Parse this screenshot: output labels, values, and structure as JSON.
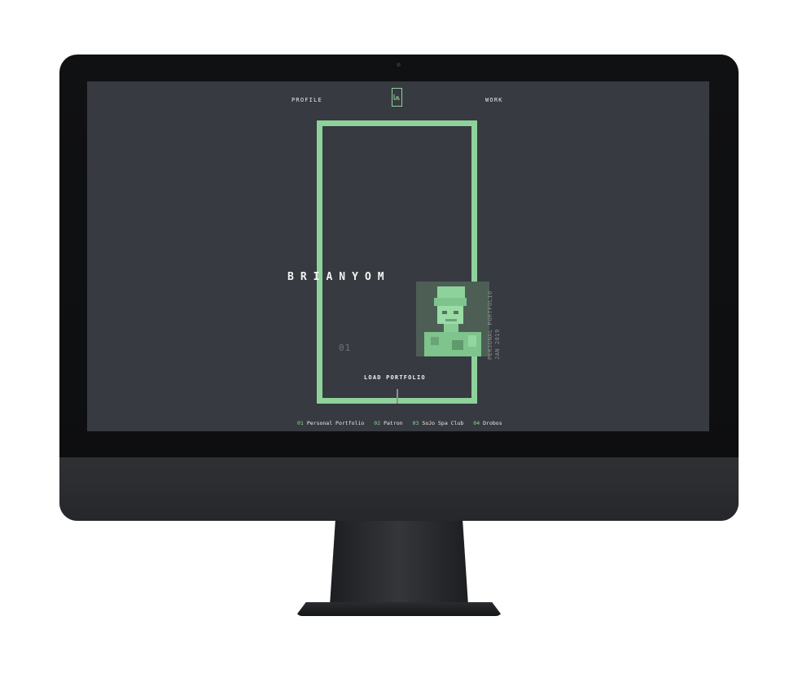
{
  "nav": {
    "profile_label": "PROFILE",
    "work_label": "WORK"
  },
  "hero": {
    "name": "BRIANYOM",
    "index": "01",
    "load_label": "LOAD PORTFOLIO",
    "vertical_label_line1": "PERSONAL PORTFOLIO",
    "vertical_label_line2": "JAN 2019"
  },
  "projects": [
    {
      "num": "01",
      "name": "Personal Portfolio"
    },
    {
      "num": "02",
      "name": "Patron"
    },
    {
      "num": "03",
      "name": "SoJo Spa Club"
    },
    {
      "num": "04",
      "name": "Drobos"
    }
  ],
  "colors": {
    "accent": "#8ed29b",
    "screen_bg": "#373a40"
  },
  "icons": {
    "logo": "brand-logo-icon",
    "portrait": "pixel-portrait-image"
  }
}
